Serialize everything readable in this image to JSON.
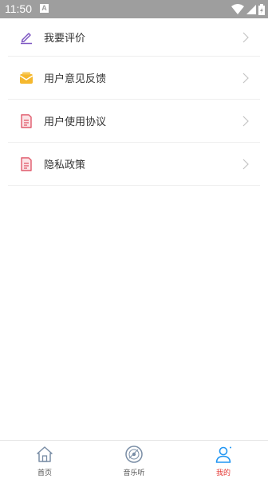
{
  "status_bar": {
    "time": "11:50",
    "notification_letter": "A"
  },
  "menu": {
    "items": [
      {
        "label": "我要评价",
        "icon": "pencil-icon"
      },
      {
        "label": "用户意见反馈",
        "icon": "envelope-icon"
      },
      {
        "label": "用户使用协议",
        "icon": "document-icon"
      },
      {
        "label": "隐私政策",
        "icon": "document-icon"
      }
    ]
  },
  "tabbar": {
    "tabs": [
      {
        "label": "首页",
        "icon": "home-icon",
        "active": false
      },
      {
        "label": "音乐听",
        "icon": "disc-icon",
        "active": false
      },
      {
        "label": "我的",
        "icon": "user-icon",
        "active": true
      }
    ]
  },
  "colors": {
    "status_bar": "#9e9e9e",
    "active_tab_label": "#e53935",
    "active_tab_icon": "#2196f3",
    "pencil_icon": "#7e57c2",
    "envelope_icon": "#f5b82e",
    "document_icon": "#e05a6b"
  }
}
